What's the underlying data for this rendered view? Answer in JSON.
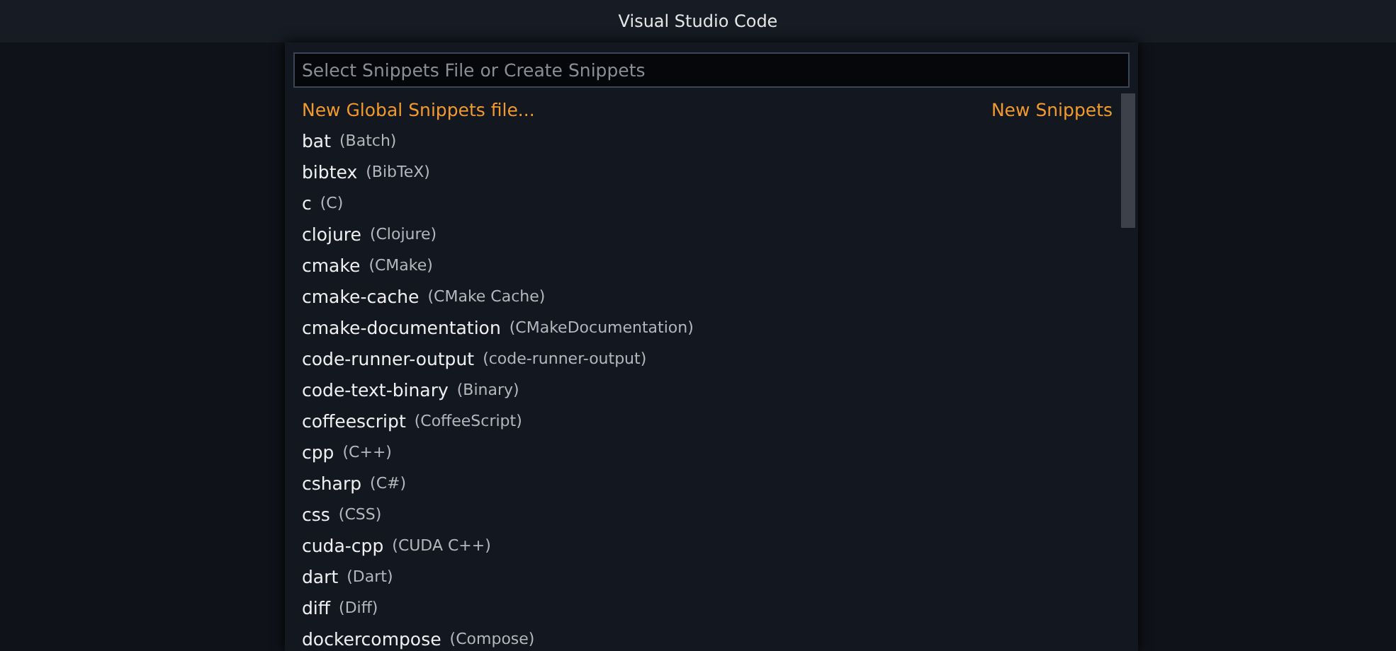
{
  "window": {
    "title": "Visual Studio Code"
  },
  "quick_pick": {
    "search": {
      "placeholder": "Select Snippets File or Create Snippets"
    },
    "items": [
      {
        "kind": "action",
        "label": "New Global Snippets file...",
        "group": "New Snippets"
      },
      {
        "kind": "language",
        "label": "bat",
        "description": "(Batch)"
      },
      {
        "kind": "language",
        "label": "bibtex",
        "description": "(BibTeX)"
      },
      {
        "kind": "language",
        "label": "c",
        "description": "(C)"
      },
      {
        "kind": "language",
        "label": "clojure",
        "description": "(Clojure)"
      },
      {
        "kind": "language",
        "label": "cmake",
        "description": "(CMake)"
      },
      {
        "kind": "language",
        "label": "cmake-cache",
        "description": "(CMake Cache)"
      },
      {
        "kind": "language",
        "label": "cmake-documentation",
        "description": "(CMakeDocumentation)"
      },
      {
        "kind": "language",
        "label": "code-runner-output",
        "description": "(code-runner-output)"
      },
      {
        "kind": "language",
        "label": "code-text-binary",
        "description": "(Binary)"
      },
      {
        "kind": "language",
        "label": "coffeescript",
        "description": "(CoffeeScript)"
      },
      {
        "kind": "language",
        "label": "cpp",
        "description": "(C++)"
      },
      {
        "kind": "language",
        "label": "csharp",
        "description": "(C#)"
      },
      {
        "kind": "language",
        "label": "css",
        "description": "(CSS)"
      },
      {
        "kind": "language",
        "label": "cuda-cpp",
        "description": "(CUDA C++)"
      },
      {
        "kind": "language",
        "label": "dart",
        "description": "(Dart)"
      },
      {
        "kind": "language",
        "label": "diff",
        "description": "(Diff)"
      },
      {
        "kind": "language",
        "label": "dockercompose",
        "description": "(Compose)"
      }
    ]
  }
}
